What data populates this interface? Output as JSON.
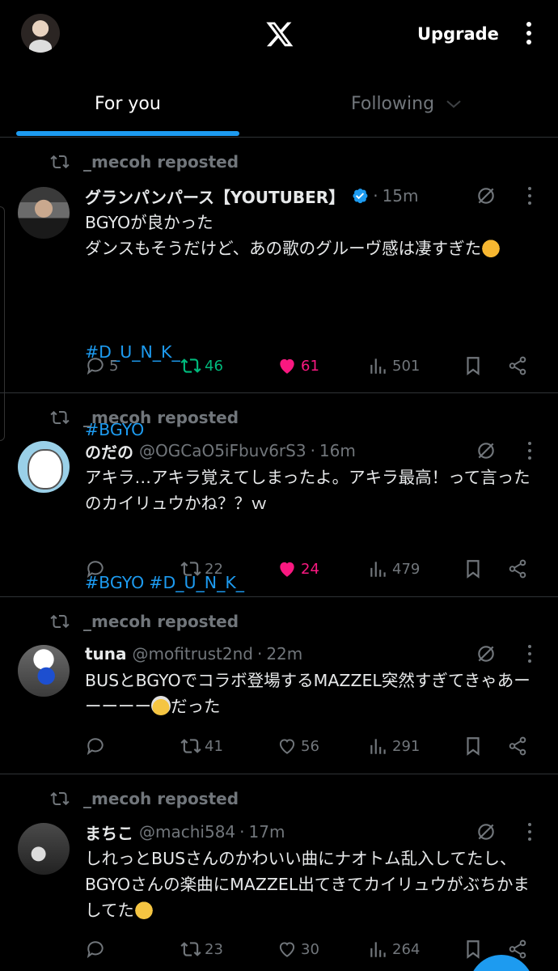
{
  "header": {
    "upgrade_label": "Upgrade",
    "logo": "x-logo",
    "avatar": "avatar"
  },
  "tabs": [
    {
      "label": "For you",
      "active": true
    },
    {
      "label": "Following",
      "active": false
    }
  ],
  "colors": {
    "accent": "#1d9bf0",
    "retweet": "#00ba7c",
    "like": "#f91880",
    "muted": "#71767b"
  },
  "posts": [
    {
      "repost_by": "_mecoh reposted",
      "name": "グランパンパース【YOUTUBER】",
      "verified": true,
      "handle": "",
      "time": "15m",
      "text": "BGYOが良かった\nダンスもそうだけど、あの歌のグルーヴ感は凄すぎた",
      "emoji": "thumbs-up-emoji",
      "hashtags": [
        "#D_U_N_K_",
        "#BGYO"
      ],
      "replies": "5",
      "reposts": "46",
      "likes": "61",
      "views": "501",
      "reposted_by_me": true,
      "liked": true
    },
    {
      "repost_by": "_mecoh reposted",
      "name": "のだの",
      "verified": false,
      "handle": "@OGCaO5iFbuv6rS3",
      "time": "16m",
      "text": "アキラ…アキラ覚えてしまったよ。アキラ最高！って言ったのカイリュウかね？？ｗ",
      "hashtags": [
        "#BGYO",
        "#D_U_N_K_"
      ],
      "replies": "",
      "reposts": "22",
      "likes": "24",
      "views": "479",
      "reposted_by_me": false,
      "liked": true
    },
    {
      "repost_by": "_mecoh reposted",
      "name": "tuna",
      "verified": false,
      "handle": "@mofitrust2nd",
      "time": "22m",
      "text": "BUSとBGYOでコラボ登場するMAZZEL突然すぎてきゃあーーーーー",
      "text_after": "だった",
      "emoji": "shocked-face-emoji",
      "hashtags": [],
      "replies": "",
      "reposts": "41",
      "likes": "56",
      "views": "291",
      "reposted_by_me": false,
      "liked": false
    },
    {
      "repost_by": "_mecoh reposted",
      "name": "まちこ",
      "verified": false,
      "handle": "@machi584",
      "time": "17m",
      "text": "しれっとBUSさんのかわいい曲にナオトム乱入してたし、BGYOさんの楽曲にMAZZEL出てきてカイリュウがぶちかましてた",
      "emoji": "grinning-sweat-emoji",
      "hashtags": [],
      "replies": "",
      "reposts": "23",
      "likes": "30",
      "views": "264",
      "reposted_by_me": false,
      "liked": false
    }
  ]
}
